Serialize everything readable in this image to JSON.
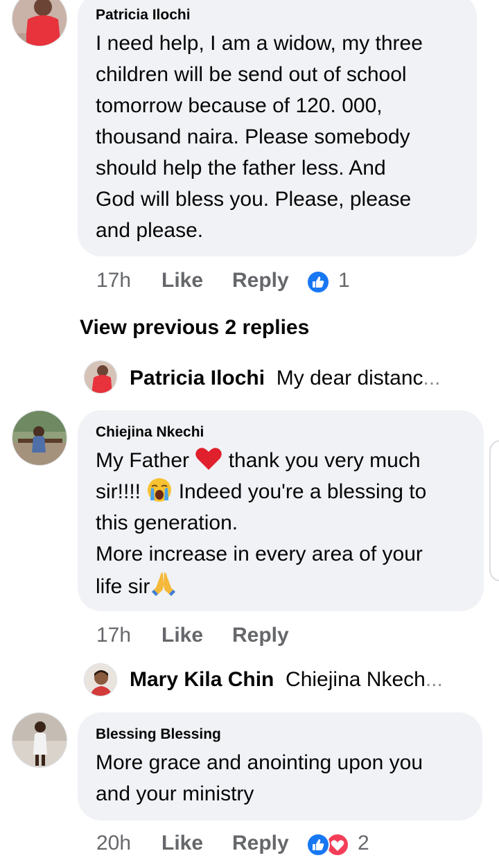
{
  "comments": [
    {
      "author": "Patricia Ilochi",
      "lines": [
        "I need help, I am a widow, my three",
        "children will be send out of school",
        "tomorrow because of 120. 000,",
        "thousand naira.  Please somebody",
        "should help the father less. And",
        "God will bless you. Please, please",
        "and please."
      ],
      "time": "17h",
      "like_label": "Like",
      "reply_label": "Reply",
      "reaction_count": "1"
    },
    {
      "author": "Chiejina Nkechi",
      "lines": [
        "My Father",
        "thank you very much",
        "sir!!!!",
        "Indeed you're a blessing to",
        "this generation.",
        "More increase in every area of your",
        "life sir"
      ],
      "time": "17h",
      "like_label": "Like",
      "reply_label": "Reply"
    },
    {
      "author": "Blessing Blessing",
      "lines": [
        "More grace and anointing upon you",
        "and your ministry"
      ],
      "time": "20h",
      "like_label": "Like",
      "reply_label": "Reply",
      "reaction_count": "2"
    }
  ],
  "view_previous": "View previous 2 replies",
  "replies": [
    {
      "author": "Patricia Ilochi",
      "preview": "My dear distanc",
      "ellipsis": "..."
    },
    {
      "author": "Mary Kila Chin",
      "preview": "Chiejina Nkech",
      "ellipsis": "..."
    }
  ],
  "icons": {
    "like_reaction": "like-reaction-icon",
    "love_reaction": "love-reaction-icon",
    "heart_emoji": "red-heart-emoji",
    "crying_emoji": "loudly-crying-face-emoji",
    "praying_emoji": "folded-hands-emoji"
  },
  "colors": {
    "bubble": "#f0f2f5",
    "meta_text": "#65676b",
    "like_blue": "#1877f2",
    "love_red": "#f33e58"
  }
}
